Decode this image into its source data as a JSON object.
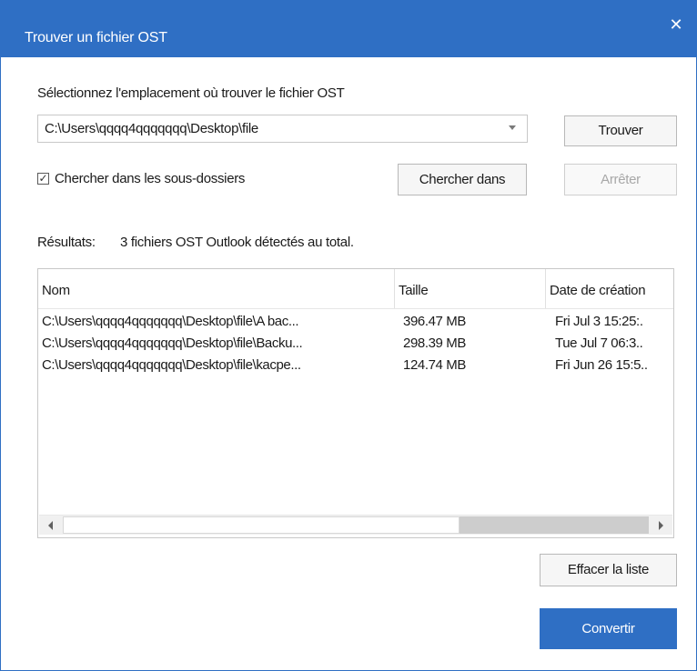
{
  "window": {
    "title": "Trouver un fichier OST",
    "close_glyph": "✕"
  },
  "location": {
    "prompt": "Sélectionnez l'emplacement où trouver le fichier OST",
    "path_value": "C:\\Users\\qqqq4qqqqqqq\\Desktop\\file"
  },
  "buttons": {
    "find": "Trouver",
    "search_in": "Chercher dans",
    "stop": "Arrêter",
    "clear_list": "Effacer la liste",
    "convert": "Convertir"
  },
  "subfolders": {
    "checked": true,
    "label": "Chercher dans les sous-dossiers",
    "check_glyph": "✓"
  },
  "results": {
    "label": "Résultats:",
    "summary": "3 fichiers OST Outlook détectés au total."
  },
  "table": {
    "columns": [
      "Nom",
      "Taille",
      "Date de création"
    ],
    "rows": [
      {
        "name": "C:\\Users\\qqqq4qqqqqqq\\Desktop\\file\\A bac...",
        "size": "396.47 MB",
        "date": "Fri Jul  3 15:25:."
      },
      {
        "name": "C:\\Users\\qqqq4qqqqqqq\\Desktop\\file\\Backu...",
        "size": "298.39 MB",
        "date": "Tue Jul  7 06:3.."
      },
      {
        "name": "C:\\Users\\qqqq4qqqqqqq\\Desktop\\file\\kacpe...",
        "size": "124.74 MB",
        "date": "Fri Jun 26 15:5.."
      }
    ]
  },
  "colors": {
    "accent": "#2f6fc4"
  }
}
